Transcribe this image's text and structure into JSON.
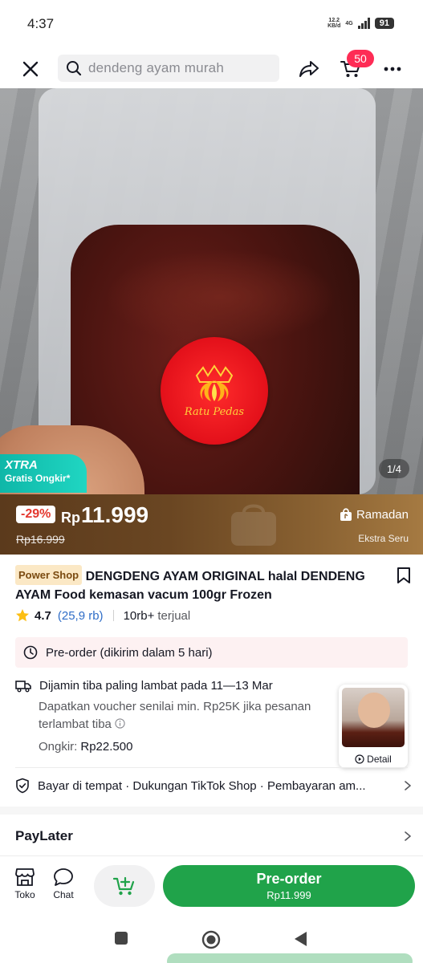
{
  "status_bar": {
    "time": "4:37",
    "net_speed_value": "12.2",
    "net_speed_unit": "KB/d",
    "network": "4G",
    "battery": "91"
  },
  "header": {
    "search_placeholder": "dendeng ayam murah",
    "cart_count": "50"
  },
  "gallery": {
    "sticker_text": "Ratu Pedas",
    "xtra_title": "XTRA",
    "xtra_subtitle": "Gratis Ongkir*",
    "page_indicator": "1/4"
  },
  "price": {
    "discount": "-29%",
    "currency": "Rp",
    "amount": "11.999",
    "original": "Rp16.999",
    "campaign": "Ramadan",
    "campaign_sub": "Ekstra Seru"
  },
  "product": {
    "shop_badge": "Power Shop",
    "title": "DENGDENG AYAM ORIGINAL halal DENDENG AYAM Food kemasan vacum 100gr Frozen",
    "rating": "4.7",
    "rating_count": "(25,9 rb)",
    "sold_count": "10rb+",
    "sold_label": "terjual"
  },
  "preorder_notice": "Pre-order (dikirim dalam 5 hari)",
  "delivery": {
    "guarantee": "Dijamin tiba paling lambat pada 11—13 Mar",
    "voucher": "Dapatkan voucher senilai min. Rp25K jika pesanan terlambat tiba",
    "shipping_label": "Ongkir:",
    "shipping_value": "Rp22.500"
  },
  "floating_video": {
    "label": "Detail"
  },
  "services": "Bayar di tempat · Dukungan TikTok Shop · Pembayaran am...",
  "paylater": "PayLater",
  "action_bar": {
    "shop_label": "Toko",
    "chat_label": "Chat",
    "preorder_label": "Pre-order",
    "preorder_price": "Rp11.999"
  },
  "colors": {
    "accent_red": "#fe2c55",
    "buy_green": "#20a34a",
    "price_banner_start": "#5b3a1c",
    "price_banner_end": "#a57a42",
    "xtra_teal": "#0fb7a8"
  },
  "icons": [
    "close-icon",
    "search-icon",
    "share-icon",
    "cart-icon",
    "more-icon",
    "bookmark-icon",
    "star-icon",
    "clock-icon",
    "truck-icon",
    "info-icon",
    "shield-icon",
    "chevron-right-icon",
    "store-icon",
    "chat-icon",
    "add-to-cart-icon",
    "square-nav-icon",
    "circle-nav-icon",
    "back-nav-icon",
    "play-icon",
    "shopping-bag-icon"
  ]
}
